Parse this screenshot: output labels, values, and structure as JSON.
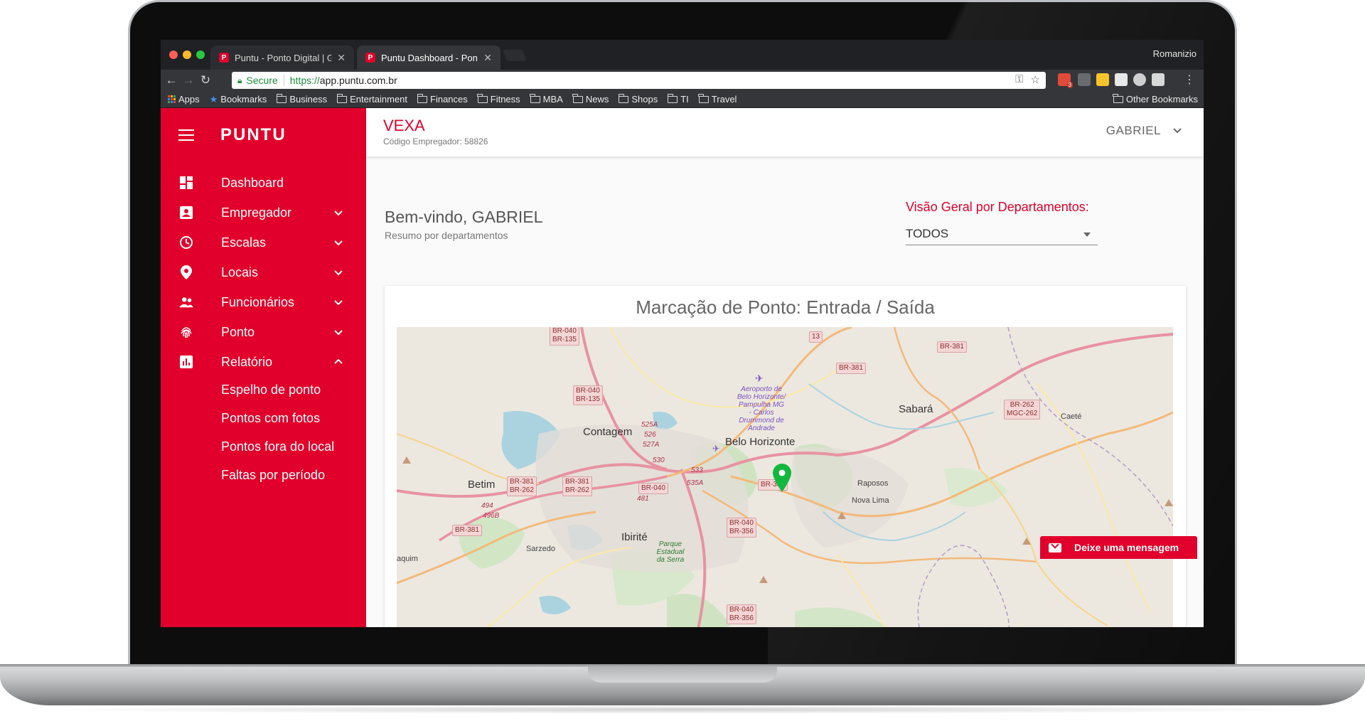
{
  "browser": {
    "tabs": [
      {
        "title": "Puntu - Ponto Digital | Gestão",
        "active": false
      },
      {
        "title": "Puntu Dashboard - Ponto Digital",
        "active": true
      }
    ],
    "profile_name": "Romanizio",
    "url": {
      "secure_label": "Secure",
      "scheme": "https://",
      "host": "app.puntu.com.br"
    },
    "bookmarks": [
      "Apps",
      "Bookmarks",
      "Business",
      "Entertainment",
      "Finances",
      "Fitness",
      "MBA",
      "News",
      "Shops",
      "TI",
      "Travel"
    ],
    "other_bookmarks": "Other Bookmarks",
    "extension_badge": "3"
  },
  "sidebar": {
    "brand": "PUNTU",
    "items": [
      {
        "label": "Dashboard",
        "icon": "dashboard-icon"
      },
      {
        "label": "Empregador",
        "icon": "contact-card-icon"
      },
      {
        "label": "Escalas",
        "icon": "clock-icon"
      },
      {
        "label": "Locais",
        "icon": "location-pin-icon"
      },
      {
        "label": "Funcionários",
        "icon": "people-icon"
      },
      {
        "label": "Ponto",
        "icon": "fingerprint-icon"
      },
      {
        "label": "Relatório",
        "icon": "bar-chart-icon"
      }
    ],
    "report_sub_items": [
      "Espelho de ponto",
      "Pontos com fotos",
      "Pontos fora do local",
      "Faltas por período"
    ]
  },
  "header": {
    "company": "VEXA",
    "company_code": "Código Empregador: 58826",
    "user": "GABRIEL"
  },
  "main": {
    "welcome": "Bem-vindo, GABRIEL",
    "welcome_sub": "Resumo por departamentos",
    "dept_label": "Visão Geral por Departamentos:",
    "dept_value": "TODOS",
    "card_title": "Marcação de Ponto: Entrada / Saída"
  },
  "map": {
    "labels": [
      "Contagem",
      "Belo Horizonte",
      "Sabará",
      "Caeté",
      "Betim",
      "Ibirité",
      "Raposos",
      "Nova Lima",
      "Sarzedo",
      "aquim"
    ],
    "shields": [
      "BR-040\nBR-135",
      "BR-381",
      "BR-381",
      "BR-040\nBR-135",
      "BR-262\nMGC-262",
      "BR-381\nBR-262",
      "BR-381\nBR-262",
      "BR-040",
      "BR-356",
      "BR-381",
      "BR-040\nBR-356",
      "BR-040\nBR-356"
    ],
    "airport": "Aeroporto de Belo Horizonte/ Pampulha MG - Carlos Drummond de Andrade",
    "park": "Parque Estadual da Serra",
    "road_numbers": [
      "525A",
      "526",
      "527A",
      "530",
      "533",
      "535A",
      "481",
      "494",
      "496B",
      "13"
    ]
  },
  "chat": {
    "label": "Deixe uma mensagem"
  },
  "colors": {
    "brand_red": "#e0002b",
    "pin_green": "#12b83e"
  }
}
